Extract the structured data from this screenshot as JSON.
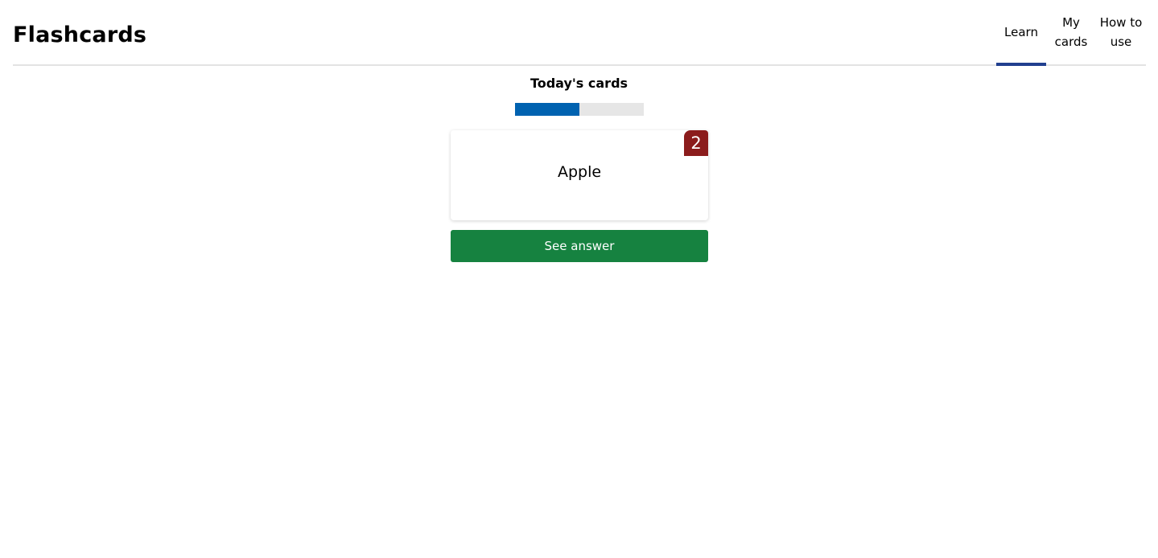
{
  "header": {
    "title": "Flashcards",
    "tabs": [
      {
        "label": "Learn",
        "active": true
      },
      {
        "label": "My cards",
        "active": false
      },
      {
        "label": "How to use",
        "active": false
      }
    ]
  },
  "session": {
    "title": "Today's cards",
    "progress_fraction": 0.5,
    "card": {
      "word": "Apple",
      "badge": "2"
    },
    "answer_button_label": "See answer"
  },
  "colors": {
    "active_tab_underline": "#213f8f",
    "progress_fill": "#0062b0",
    "progress_track": "#e6e6e6",
    "badge": "#8b1c1c",
    "answer_button": "#168240"
  }
}
